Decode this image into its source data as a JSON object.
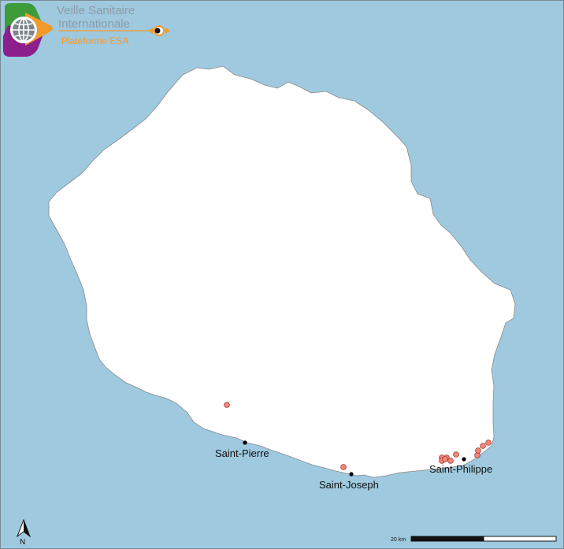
{
  "header": {
    "title_line1": "Veille Sanitaire",
    "title_line2": "Internationale",
    "subtitle": "Plateforme ESA"
  },
  "map": {
    "towns": [
      {
        "name": "Saint-Pierre"
      },
      {
        "name": "Saint-Joseph"
      },
      {
        "name": "Saint-Philippe"
      }
    ],
    "case_count": 12
  },
  "north_arrow": {
    "label": "N"
  },
  "scale_bar": {
    "label": "20 km"
  },
  "colors": {
    "sea": "#9ec9df",
    "land": "#ffffff",
    "case_marker": "#f4867a",
    "town_marker": "#000000",
    "logo_green": "#3d9b3a",
    "logo_purple": "#8b1f8b",
    "logo_orange": "#f29a2e"
  }
}
